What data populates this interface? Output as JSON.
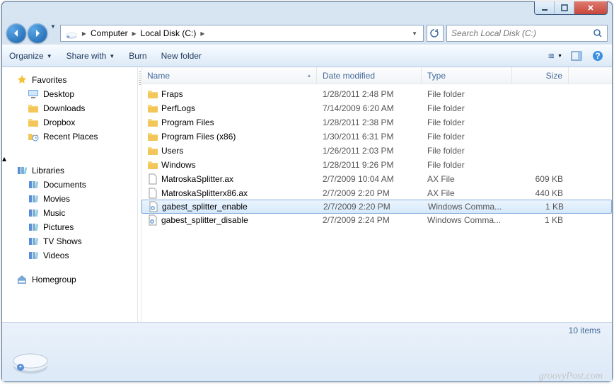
{
  "breadcrumb": {
    "a": "Computer",
    "b": "Local Disk (C:)"
  },
  "search": {
    "placeholder": "Search Local Disk (C:)"
  },
  "toolbar": {
    "organize": "Organize",
    "share": "Share with",
    "burn": "Burn",
    "newfolder": "New folder"
  },
  "sidebar": {
    "favorites": {
      "label": "Favorites",
      "items": [
        "Desktop",
        "Downloads",
        "Dropbox",
        "Recent Places"
      ]
    },
    "libraries": {
      "label": "Libraries",
      "items": [
        "Documents",
        "Movies",
        "Music",
        "Pictures",
        "TV Shows",
        "Videos"
      ]
    },
    "homegroup": {
      "label": "Homegroup"
    }
  },
  "columns": {
    "name": "Name",
    "date": "Date modified",
    "type": "Type",
    "size": "Size"
  },
  "files": [
    {
      "name": "Fraps",
      "date": "1/28/2011 2:48 PM",
      "type": "File folder",
      "size": "",
      "icon": "folder"
    },
    {
      "name": "PerfLogs",
      "date": "7/14/2009 6:20 AM",
      "type": "File folder",
      "size": "",
      "icon": "folder"
    },
    {
      "name": "Program Files",
      "date": "1/28/2011 2:38 PM",
      "type": "File folder",
      "size": "",
      "icon": "folder"
    },
    {
      "name": "Program Files (x86)",
      "date": "1/30/2011 6:31 PM",
      "type": "File folder",
      "size": "",
      "icon": "folder"
    },
    {
      "name": "Users",
      "date": "1/26/2011 2:03 PM",
      "type": "File folder",
      "size": "",
      "icon": "folder"
    },
    {
      "name": "Windows",
      "date": "1/28/2011 9:26 PM",
      "type": "File folder",
      "size": "",
      "icon": "folder"
    },
    {
      "name": "MatroskaSplitter.ax",
      "date": "2/7/2009 10:04 AM",
      "type": "AX File",
      "size": "609 KB",
      "icon": "file"
    },
    {
      "name": "MatroskaSplitterx86.ax",
      "date": "2/7/2009 2:20 PM",
      "type": "AX File",
      "size": "440 KB",
      "icon": "file"
    },
    {
      "name": "gabest_splitter_enable",
      "date": "2/7/2009 2:20 PM",
      "type": "Windows Comma...",
      "size": "1 KB",
      "icon": "cmd",
      "selected": true
    },
    {
      "name": "gabest_splitter_disable",
      "date": "2/7/2009 2:24 PM",
      "type": "Windows Comma...",
      "size": "1 KB",
      "icon": "cmd"
    }
  ],
  "status": {
    "count": "10 items"
  },
  "watermark": "groovyPost.com"
}
